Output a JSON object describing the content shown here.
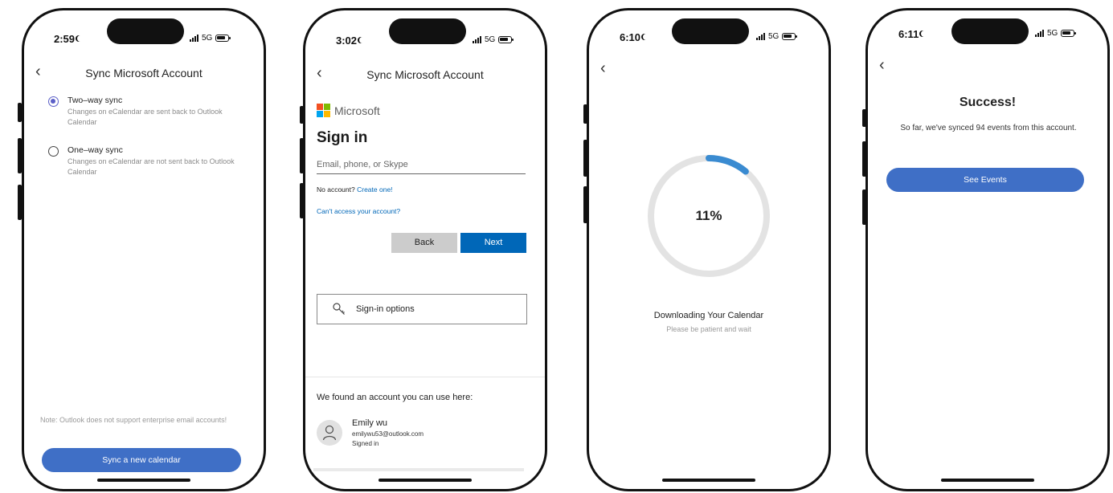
{
  "screens": [
    {
      "status": {
        "time": "2:59",
        "network": "5G"
      },
      "header": {
        "title": "Sync Microsoft Account"
      },
      "options": [
        {
          "title": "Two–way sync",
          "desc": "Changes on eCalendar are sent back to Outlook Calendar",
          "selected": true
        },
        {
          "title": "One–way sync",
          "desc": "Changes on eCalendar are not sent back to Outlook Calendar",
          "selected": false
        }
      ],
      "note": "Note: Outlook does not support enterprise email accounts!",
      "primary_button": "Sync a new calendar"
    },
    {
      "status": {
        "time": "3:02",
        "network": "5G"
      },
      "header": {
        "title": "Sync Microsoft Account"
      },
      "brand": "Microsoft",
      "heading": "Sign in",
      "email_placeholder": "Email, phone, or Skype",
      "no_account_prefix": "No account?",
      "create_link": "Create one!",
      "cant_access_link": "Can't access your account?",
      "back_button": "Back",
      "next_button": "Next",
      "signin_options": "Sign-in options",
      "found_text": "We found an account you can use here:",
      "account": {
        "name": "Emily wu",
        "email": "emilywu53@outlook.com",
        "status": "Signed in"
      }
    },
    {
      "status": {
        "time": "6:10",
        "network": "5G"
      },
      "progress": {
        "value": 0.11,
        "label": "11%"
      },
      "title": "Downloading Your Calendar",
      "subtitle": "Please be patient and wait"
    },
    {
      "status": {
        "time": "6:11",
        "network": "5G"
      },
      "heading": "Success!",
      "message": "So far, we've synced 94 events from this account.",
      "primary_button": "See Events"
    }
  ],
  "colors": {
    "accent": "#3f6fc6",
    "ms_blue": "#0067b8",
    "radio": "#5b5fc7",
    "progress": "#3a8bd1"
  },
  "icons": [
    "back-chevron-icon",
    "moon-icon",
    "signal-icon",
    "battery-icon",
    "key-icon",
    "person-icon",
    "microsoft-logo-icon"
  ]
}
